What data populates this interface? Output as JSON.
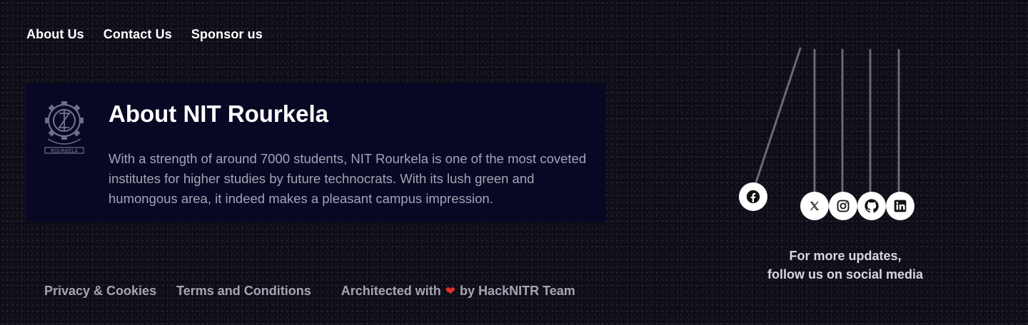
{
  "nav": {
    "about": "About Us",
    "contact": "Contact Us",
    "sponsor": "Sponsor us"
  },
  "about_card": {
    "title": "About NIT Rourkela",
    "text": "With a strength of around 7000 students, NIT Rourkela is one of the most coveted institutes for higher studies by future technocrats. With its lush green and humongous area, it indeed makes a pleasant campus impression.",
    "logo": {
      "icon": "nit-rourkela-logo-icon",
      "seal_text": "ROURKELA"
    }
  },
  "footer": {
    "privacy": "Privacy & Cookies",
    "terms": "Terms and Conditions",
    "credit_prefix": "Architected with",
    "credit_suffix": "by HackNITR Team",
    "heart_icon": "heart-icon",
    "heart_color": "#e0312b"
  },
  "social": {
    "caption_line1": "For more updates,",
    "caption_line2": "follow us on social media",
    "icons": [
      "facebook-icon",
      "x-twitter-icon",
      "instagram-icon",
      "github-icon",
      "linkedin-icon"
    ]
  },
  "colors": {
    "background": "#0d0c17",
    "card": "#080824",
    "muted_text": "#a6a3b5"
  }
}
